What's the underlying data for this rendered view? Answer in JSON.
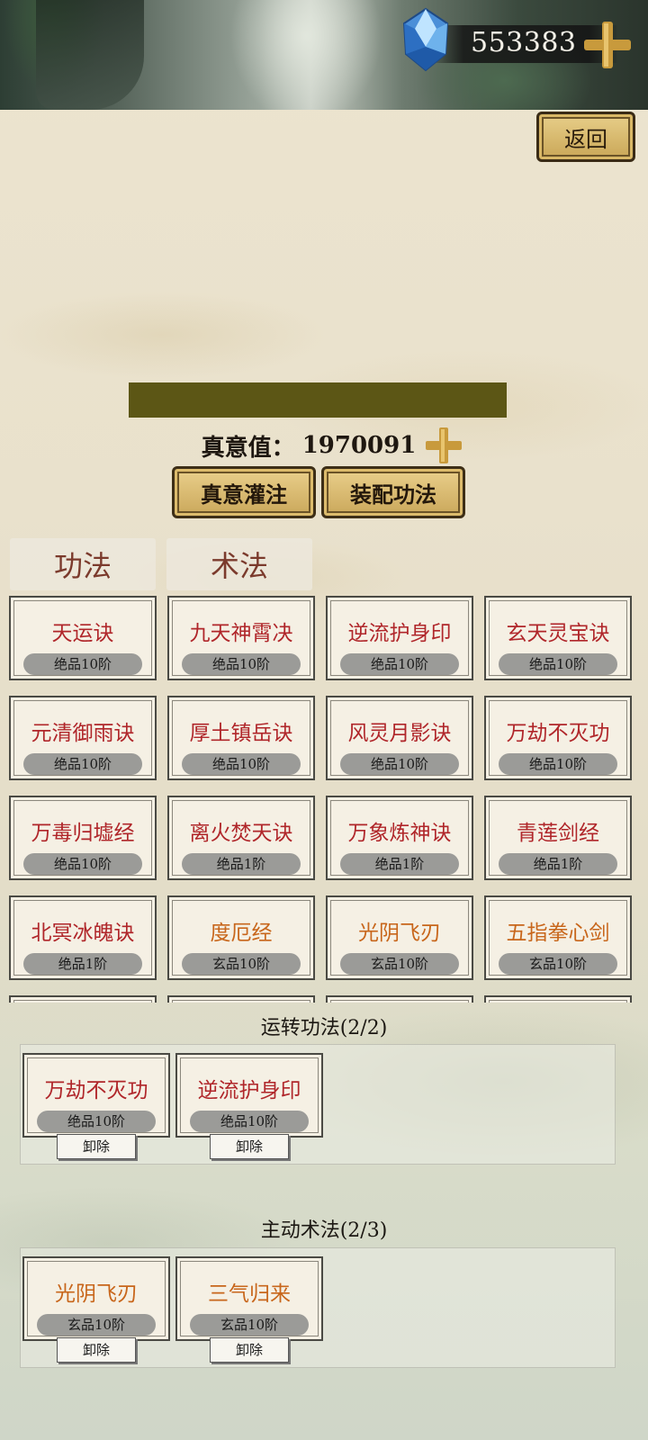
{
  "currency": {
    "gem_icon": "blue-crystal-icon",
    "value": "553383",
    "add_icon": "gold-plus-icon"
  },
  "back_button": "返回",
  "truth_value": {
    "label": "真意值：",
    "value": "1970091"
  },
  "buttons": {
    "infuse": "真意灌注",
    "equip": "装配功法"
  },
  "tabs": [
    {
      "label": "功法"
    },
    {
      "label": "术法"
    }
  ],
  "skills": [
    {
      "name": "天运诀",
      "grade": "绝品10阶",
      "color": "#b0262a"
    },
    {
      "name": "九天神霄决",
      "grade": "绝品10阶",
      "color": "#b0262a"
    },
    {
      "name": "逆流护身印",
      "grade": "绝品10阶",
      "color": "#b0262a"
    },
    {
      "name": "玄天灵宝诀",
      "grade": "绝品10阶",
      "color": "#b0262a"
    },
    {
      "name": "元清御雨诀",
      "grade": "绝品10阶",
      "color": "#b0262a"
    },
    {
      "name": "厚土镇岳诀",
      "grade": "绝品10阶",
      "color": "#b0262a"
    },
    {
      "name": "风灵月影诀",
      "grade": "绝品10阶",
      "color": "#b0262a"
    },
    {
      "name": "万劫不灭功",
      "grade": "绝品10阶",
      "color": "#b0262a"
    },
    {
      "name": "万毒归墟经",
      "grade": "绝品10阶",
      "color": "#b0262a"
    },
    {
      "name": "离火焚天诀",
      "grade": "绝品1阶",
      "color": "#b0262a"
    },
    {
      "name": "万象炼神诀",
      "grade": "绝品1阶",
      "color": "#b0262a"
    },
    {
      "name": "青莲剑经",
      "grade": "绝品1阶",
      "color": "#b0262a"
    },
    {
      "name": "北冥冰魄诀",
      "grade": "绝品1阶",
      "color": "#b0262a"
    },
    {
      "name": "度厄经",
      "grade": "玄品10阶",
      "color": "#c8661b"
    },
    {
      "name": "光阴飞刃",
      "grade": "玄品10阶",
      "color": "#c8661b"
    },
    {
      "name": "五指拳心剑",
      "grade": "玄品10阶",
      "color": "#c8661b"
    }
  ],
  "running_section": {
    "title": "运转功法(2/2)",
    "items": [
      {
        "name": "万劫不灭功",
        "grade": "绝品10阶",
        "action": "卸除"
      },
      {
        "name": "逆流护身印",
        "grade": "绝品10阶",
        "action": "卸除"
      }
    ]
  },
  "active_section": {
    "title": "主动术法(2/3)",
    "items": [
      {
        "name": "光阴飞刃",
        "grade": "玄品10阶",
        "action": "卸除"
      },
      {
        "name": "三气归来",
        "grade": "玄品10阶",
        "action": "卸除"
      }
    ]
  }
}
